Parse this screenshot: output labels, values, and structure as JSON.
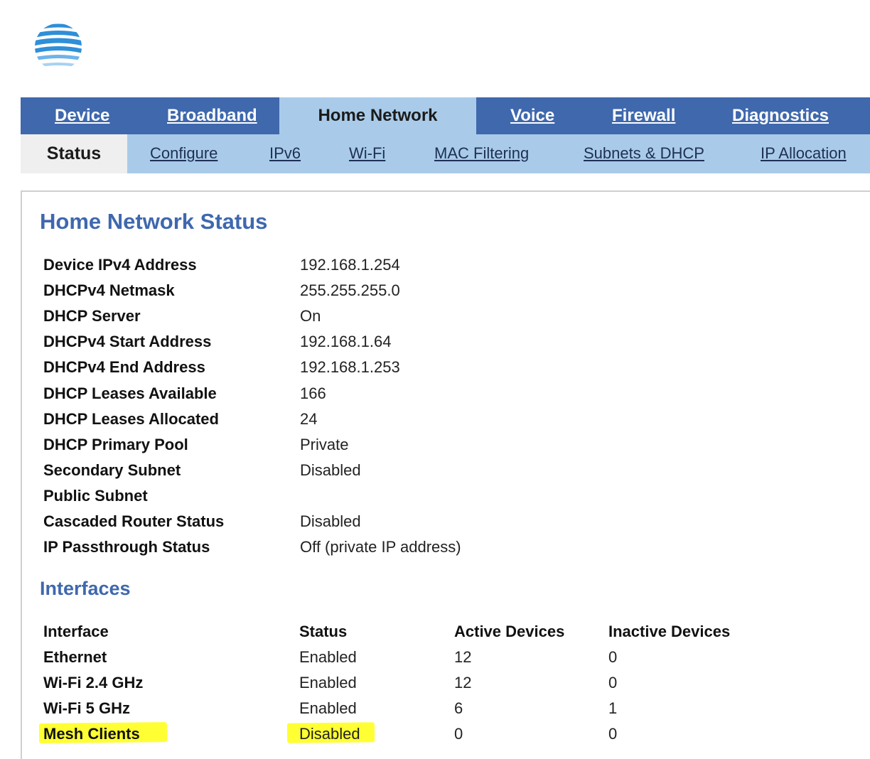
{
  "brand": {
    "logo": "att-globe-icon",
    "accent": "#3f68ad",
    "light_accent": "#a9cbe9"
  },
  "topnav": {
    "tabs": [
      {
        "label": "Device"
      },
      {
        "label": "Broadband"
      },
      {
        "label": "Home Network",
        "active": true
      },
      {
        "label": "Voice"
      },
      {
        "label": "Firewall"
      },
      {
        "label": "Diagnostics"
      }
    ]
  },
  "subnav": {
    "tabs": [
      {
        "label": "Status",
        "active": true
      },
      {
        "label": "Configure"
      },
      {
        "label": "IPv6"
      },
      {
        "label": "Wi-Fi"
      },
      {
        "label": "MAC Filtering"
      },
      {
        "label": "Subnets & DHCP"
      },
      {
        "label": "IP Allocation"
      }
    ]
  },
  "status": {
    "title": "Home Network Status",
    "rows": [
      {
        "label": "Device IPv4 Address",
        "value": "192.168.1.254"
      },
      {
        "label": "DHCPv4 Netmask",
        "value": "255.255.255.0"
      },
      {
        "label": "DHCP Server",
        "value": "On"
      },
      {
        "label": "DHCPv4 Start Address",
        "value": "192.168.1.64"
      },
      {
        "label": "DHCPv4 End Address",
        "value": "192.168.1.253"
      },
      {
        "label": "DHCP Leases Available",
        "value": "166"
      },
      {
        "label": "DHCP Leases Allocated",
        "value": "24"
      },
      {
        "label": "DHCP Primary Pool",
        "value": "Private"
      },
      {
        "label": "Secondary Subnet",
        "value": "Disabled"
      },
      {
        "label": "Public Subnet",
        "value": ""
      },
      {
        "label": "Cascaded Router Status",
        "value": "Disabled"
      },
      {
        "label": "IP Passthrough Status",
        "value": "Off (private IP address)"
      }
    ]
  },
  "interfaces": {
    "title": "Interfaces",
    "headers": [
      "Interface",
      "Status",
      "Active Devices",
      "Inactive Devices"
    ],
    "rows": [
      [
        "Ethernet",
        "Enabled",
        "12",
        "0"
      ],
      [
        "Wi-Fi 2.4 GHz",
        "Enabled",
        "12",
        "0"
      ],
      [
        "Wi-Fi 5 GHz",
        "Enabled",
        "6",
        "1"
      ],
      [
        "Mesh Clients",
        "Disabled",
        "0",
        "0"
      ]
    ],
    "highlight_color": "#ffff33"
  }
}
